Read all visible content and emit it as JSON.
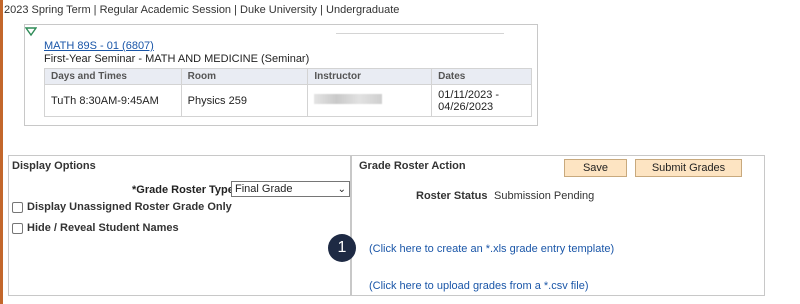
{
  "term_header": "2023 Spring Term | Regular Academic Session | Duke University | Undergraduate",
  "class_section": {
    "toggle_icon": "triangle-down-icon",
    "link": "MATH 89S - 01 (6807)",
    "description": "First-Year Seminar - MATH AND MEDICINE (Seminar)",
    "columns": [
      "Days and Times",
      "Room",
      "Instructor",
      "Dates"
    ],
    "row": {
      "days_times": "TuTh 8:30AM-9:45AM",
      "room": "Physics 259",
      "instructor": "",
      "dates_line1": "01/11/2023 -",
      "dates_line2": "04/26/2023"
    }
  },
  "display_options": {
    "title": "Display Options",
    "grade_roster_type_label": "*Grade Roster Type",
    "grade_roster_type_value": "Final Grade",
    "unassigned_label": "Display Unassigned Roster Grade Only",
    "hide_names_label": "Hide / Reveal Student Names"
  },
  "roster_action": {
    "title": "Grade Roster Action",
    "save_label": "Save",
    "submit_label": "Submit Grades",
    "status_label": "Roster Status",
    "status_value": "Submission Pending",
    "xls_link": "(Click here to create an *.xls grade entry template)",
    "csv_link": "(Click here to upload grades from a *.csv file)"
  },
  "callout_number": "1",
  "colors": {
    "accent_edge": "#c3672b",
    "link": "#1a56a8",
    "button_bg": "#fde4c2",
    "header_bg": "#e9ecf3",
    "callout_bg": "#1e2a44",
    "toggle_green": "#2e8b57"
  }
}
